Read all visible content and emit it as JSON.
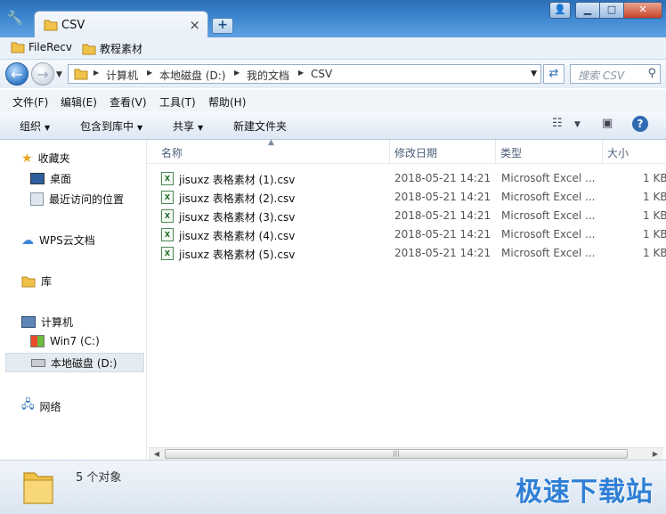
{
  "window": {
    "tab_title": "CSV",
    "tab_close": "×",
    "new_tab": "+",
    "tools_icon": "wrench-icon"
  },
  "favorites": [
    "FileRecv",
    "教程素材"
  ],
  "nav": {
    "breadcrumb": [
      "计算机",
      "本地磁盘 (D:)",
      "我的文档",
      "CSV"
    ],
    "search_placeholder": "搜索 CSV"
  },
  "menu": [
    "文件(F)",
    "编辑(E)",
    "查看(V)",
    "工具(T)",
    "帮助(H)"
  ],
  "commands": {
    "organize": "组织",
    "include_in_library": "包含到库中",
    "share": "共享",
    "new_folder": "新建文件夹"
  },
  "sidebar": {
    "favorites": "收藏夹",
    "desktop": "桌面",
    "recent": "最近访问的位置",
    "wps": "WPS云文档",
    "library": "库",
    "computer": "计算机",
    "drive_c": "Win7 (C:)",
    "drive_d": "本地磁盘 (D:)",
    "network": "网络"
  },
  "columns": {
    "name": "名称",
    "date": "修改日期",
    "type": "类型",
    "size": "大小"
  },
  "files": [
    {
      "name": "jisuxz 表格素材 (1).csv",
      "date": "2018-05-21 14:21",
      "type": "Microsoft Excel ...",
      "size": "1 KB"
    },
    {
      "name": "jisuxz 表格素材 (2).csv",
      "date": "2018-05-21 14:21",
      "type": "Microsoft Excel ...",
      "size": "1 KB"
    },
    {
      "name": "jisuxz 表格素材 (3).csv",
      "date": "2018-05-21 14:21",
      "type": "Microsoft Excel ...",
      "size": "1 KB"
    },
    {
      "name": "jisuxz 表格素材 (4).csv",
      "date": "2018-05-21 14:21",
      "type": "Microsoft Excel ...",
      "size": "1 KB"
    },
    {
      "name": "jisuxz 表格素材 (5).csv",
      "date": "2018-05-21 14:21",
      "type": "Microsoft Excel ...",
      "size": "1 KB"
    }
  ],
  "status": {
    "count": "5 个对象"
  },
  "watermark": "极速下载站",
  "colors": {
    "title_blue": "#3d86cf",
    "folder_yellow": "#f0c24a",
    "excel_green": "#1f6b2c",
    "watermark_blue": "#2f7fd6"
  }
}
